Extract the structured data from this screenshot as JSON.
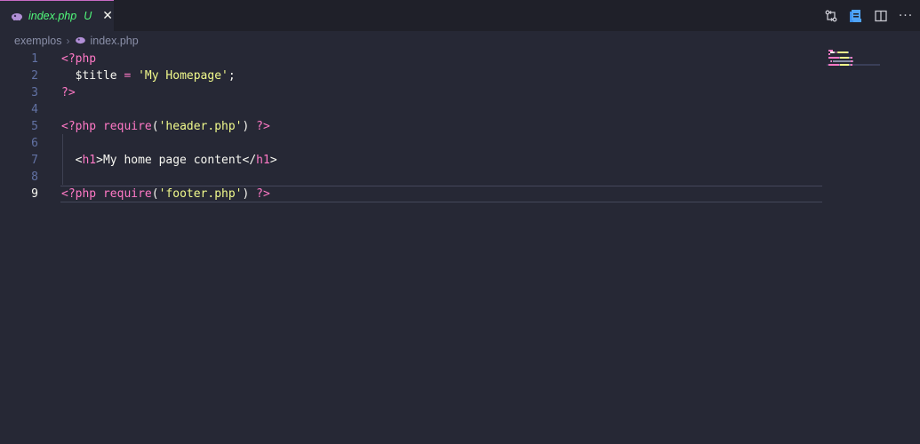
{
  "tab": {
    "filename": "index.php",
    "status": "U",
    "close": "✕"
  },
  "breadcrumb": {
    "folder": "exemplos",
    "separator": "›",
    "file": "index.php"
  },
  "actions": [
    "open-changes-icon",
    "php-debug-icon",
    "split-editor-icon",
    "more-actions-icon"
  ],
  "actions_more": "···",
  "editor": {
    "active_line": 9,
    "lines": [
      {
        "n": "1",
        "tokens": [
          {
            "c": "t-tag",
            "t": "<?php"
          }
        ]
      },
      {
        "n": "2",
        "tokens": [
          {
            "c": "t-plain",
            "t": "  "
          },
          {
            "c": "t-var",
            "t": "$title"
          },
          {
            "c": "t-plain",
            "t": " "
          },
          {
            "c": "t-op",
            "t": "="
          },
          {
            "c": "t-plain",
            "t": " "
          },
          {
            "c": "t-str",
            "t": "'My Homepage'"
          },
          {
            "c": "t-plain",
            "t": ";"
          }
        ]
      },
      {
        "n": "3",
        "tokens": [
          {
            "c": "t-tag",
            "t": "?>"
          }
        ]
      },
      {
        "n": "4",
        "tokens": []
      },
      {
        "n": "5",
        "tokens": [
          {
            "c": "t-tag",
            "t": "<?php"
          },
          {
            "c": "t-plain",
            "t": " "
          },
          {
            "c": "t-func",
            "t": "require"
          },
          {
            "c": "t-plain",
            "t": "("
          },
          {
            "c": "t-str",
            "t": "'header.php'"
          },
          {
            "c": "t-plain",
            "t": ") "
          },
          {
            "c": "t-tag",
            "t": "?>"
          }
        ]
      },
      {
        "n": "6",
        "tokens": []
      },
      {
        "n": "7",
        "tokens": [
          {
            "c": "t-plain",
            "t": "  "
          },
          {
            "c": "t-plain",
            "t": "<"
          },
          {
            "c": "t-tag",
            "t": "h1"
          },
          {
            "c": "t-plain",
            "t": ">My home page content</"
          },
          {
            "c": "t-tag",
            "t": "h1"
          },
          {
            "c": "t-plain",
            "t": ">"
          }
        ]
      },
      {
        "n": "8",
        "tokens": []
      },
      {
        "n": "9",
        "tokens": [
          {
            "c": "t-tag",
            "t": "<?php"
          },
          {
            "c": "t-plain",
            "t": " "
          },
          {
            "c": "t-func",
            "t": "require"
          },
          {
            "c": "t-plain",
            "t": "("
          },
          {
            "c": "t-str",
            "t": "'footer.php'"
          },
          {
            "c": "t-plain",
            "t": ") "
          },
          {
            "c": "t-tag",
            "t": "?>"
          }
        ]
      }
    ]
  },
  "colors": {
    "background": "#262835",
    "tabbar": "#1f2029",
    "tab_accent": "#c96ac5",
    "modified_green": "#50fa7b",
    "keyword_pink": "#ff79c6",
    "string_yellow": "#f1fa8c",
    "line_number": "#6272a4"
  }
}
